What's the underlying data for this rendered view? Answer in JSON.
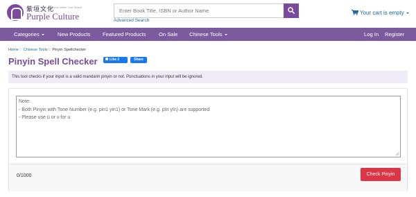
{
  "header": {
    "logo": {
      "chinese": "紫垣文化",
      "tagline": "A China Within Your Reach",
      "english": "Purple Culture"
    },
    "search": {
      "placeholder": "Enter Book Title, ISBN or Author Name",
      "value": "",
      "button_icon": "search-icon",
      "advanced_label": "Advanced Search"
    },
    "cart": {
      "icon": "cart-icon",
      "label": "Your cart is empty"
    }
  },
  "nav": {
    "items": [
      {
        "label": "Categories",
        "dropdown": true
      },
      {
        "label": "New Products",
        "dropdown": false
      },
      {
        "label": "Featured Products",
        "dropdown": false
      },
      {
        "label": "On Sale",
        "dropdown": false
      },
      {
        "label": "Chinese Tools",
        "dropdown": true
      }
    ],
    "login": "Log In",
    "register": "Register"
  },
  "breadcrumb": {
    "home": "Home",
    "tools": "Chinese Tools",
    "current": "Pinyin Spellchecker",
    "separator": "::"
  },
  "page": {
    "title": "Pinyin Spell Checker",
    "fb_like": "Like 2",
    "fb_share": "Share",
    "info": "This tool checks if your input is a valid mandarin pinyin or not. Punctuations in your input will be ignored."
  },
  "checker": {
    "note_lines": [
      "Note:",
      "- Both Pinyin with Tone Number (e.g. pin1 yin1) or Tone Mark (e.g. pīn yīn) are supported",
      "- Please use ü or v for u"
    ],
    "counter": "0/1000",
    "button_label": "Check Pinyin"
  },
  "colors": {
    "brand_purple": "#7b5a9e",
    "link_blue": "#1a6aa3",
    "info_bg": "#f0ecf7",
    "button_red": "#dc3545",
    "facebook_blue": "#1877f2"
  }
}
